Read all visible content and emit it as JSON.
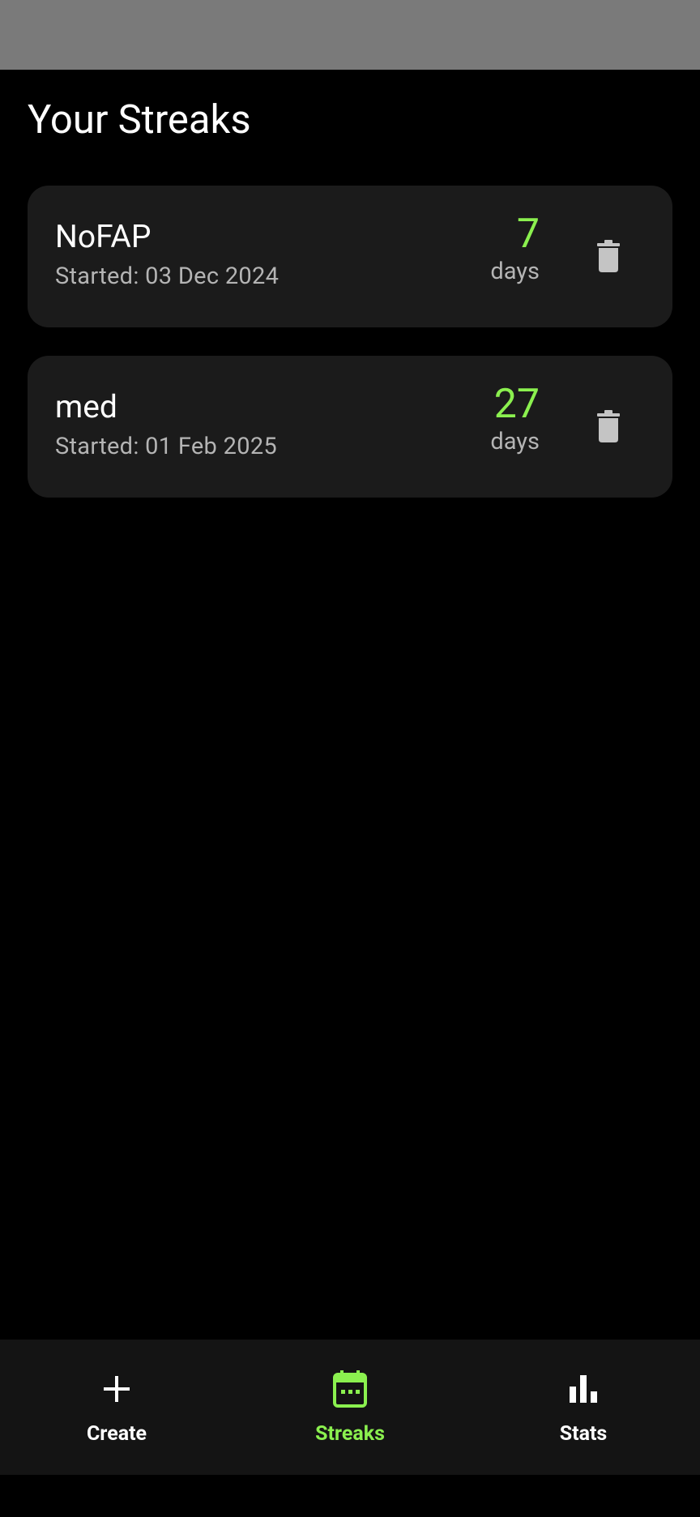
{
  "header": {
    "title": "Your Streaks"
  },
  "streaks": [
    {
      "name": "NoFAP",
      "started": "Started: 03 Dec 2024",
      "count": "7",
      "unit": "days"
    },
    {
      "name": "med",
      "started": "Started: 01 Feb 2025",
      "count": "27",
      "unit": "days"
    }
  ],
  "nav": {
    "items": [
      {
        "label": "Create",
        "icon": "plus-icon",
        "active": false
      },
      {
        "label": "Streaks",
        "icon": "calendar-icon",
        "active": true
      },
      {
        "label": "Stats",
        "icon": "bar-chart-icon",
        "active": false
      }
    ]
  },
  "colors": {
    "accent": "#8bf04f",
    "background": "#000000",
    "card": "#1b1b1b",
    "nav_background": "#141414",
    "status_bar": "#7a7a7a",
    "muted_text": "#b4b4b4"
  }
}
